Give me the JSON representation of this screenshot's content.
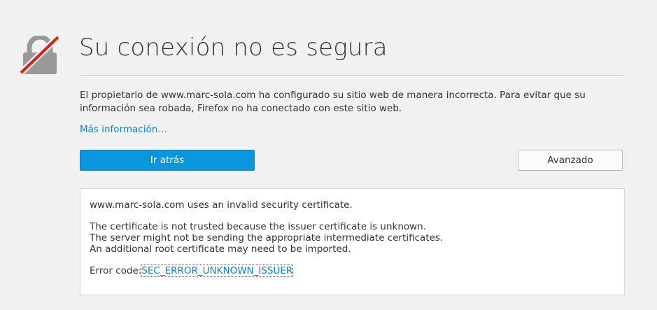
{
  "colors": {
    "background": "#f1f1f1",
    "accent": "#0996dd",
    "link": "#0a84c9",
    "lock_gray": "#999999",
    "strike_red": "#d92215"
  },
  "icon": "broken-lock-icon",
  "title": "Su conexión no es segura",
  "description": "El propietario de www.marc-sola.com ha configurado su sitio web de manera incorrecta. Para evitar que su información sea robada, Firefox no ha conectado con este sitio web.",
  "more_info_link": "Más información…",
  "buttons": {
    "back": "Ir atrás",
    "advanced": "Avanzado"
  },
  "details": {
    "line1": "www.marc-sola.com uses an invalid security certificate.",
    "line2": "The certificate is not trusted because the issuer certificate is unknown.",
    "line3": "The server might not be sending the appropriate intermediate certificates.",
    "line4": "An additional root certificate may need to be imported.",
    "error_label": "Error code:",
    "error_code": "SEC_ERROR_UNKNOWN_ISSUER"
  }
}
